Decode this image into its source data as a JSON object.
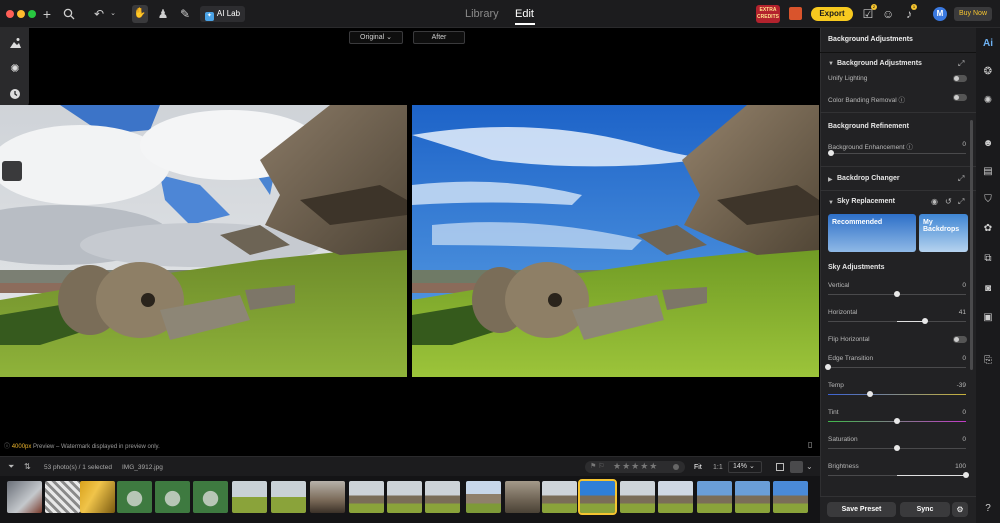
{
  "header": {
    "modes": [
      "Library",
      "Edit"
    ],
    "ai_lab": "AI Lab",
    "extra_label": "EXTRA CREDITS",
    "export": "Export",
    "avatar": "M",
    "buy_now": "Buy Now",
    "badges": [
      "2",
      "1"
    ]
  },
  "view": {
    "original": "Original",
    "after": "After",
    "watermark_px": "4000px",
    "watermark_text": " Preview – Watermark displayed in preview only."
  },
  "filmbar": {
    "count": "53 photo(s) / 1 selected",
    "filename": "IMG_3912.jpg",
    "fit": "Fit",
    "one_to_one": "1:1",
    "zoom": "14%",
    "stars": "★★★★★",
    "flags": "⚑ ⚐"
  },
  "panel": {
    "title": "Background Adjustments",
    "bg_adjust_section": "Background Adjustments",
    "unify_lighting": "Unify Lighting",
    "color_banding": "Color Banding Removal",
    "bg_refinement": "Background Refinement",
    "bg_enhancement": "Background Enhancement",
    "bg_enhancement_value": "0",
    "backdrop_changer": "Backdrop Changer",
    "sky_replacement": "Sky Replacement",
    "recommended": "Recommended",
    "my_backdrops": "My Backdrops",
    "sky_adjustments": "Sky Adjustments",
    "sliders": [
      {
        "label": "Vertical",
        "value": "0",
        "pos": 0.5
      },
      {
        "label": "Horizontal",
        "value": "41",
        "pos": 0.705
      },
      {
        "label": "Edge Transition",
        "value": "0",
        "pos": 0
      },
      {
        "label": "Temp",
        "value": "-39",
        "pos": 0.305
      },
      {
        "label": "Tint",
        "value": "0",
        "pos": 0.5
      },
      {
        "label": "Saturation",
        "value": "0",
        "pos": 0.5
      },
      {
        "label": "Brightness",
        "value": "100",
        "pos": 1
      }
    ],
    "flip_horizontal": "Flip Horizontal",
    "save_preset": "Save Preset",
    "sync": "Sync"
  },
  "colors": {
    "accent": "#f5c430",
    "panel": "#222224",
    "sky_blue": "#2f7fd8"
  }
}
